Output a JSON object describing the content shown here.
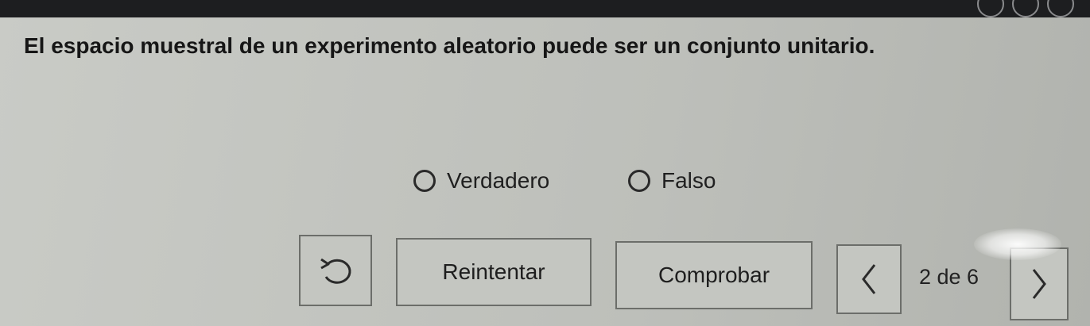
{
  "question": {
    "text": "El espacio muestral de un experimento aleatorio puede ser un conjunto unitario."
  },
  "options": [
    {
      "label": "Verdadero",
      "selected": false
    },
    {
      "label": "Falso",
      "selected": false
    }
  ],
  "controls": {
    "reset_icon": "undo-arrow-icon",
    "retry_label": "Reintentar",
    "check_label": "Comprobar",
    "prev_icon": "chevron-left-icon",
    "next_icon": "chevron-right-icon"
  },
  "pagination": {
    "text": "2 de 6",
    "current": 2,
    "total": 6
  }
}
